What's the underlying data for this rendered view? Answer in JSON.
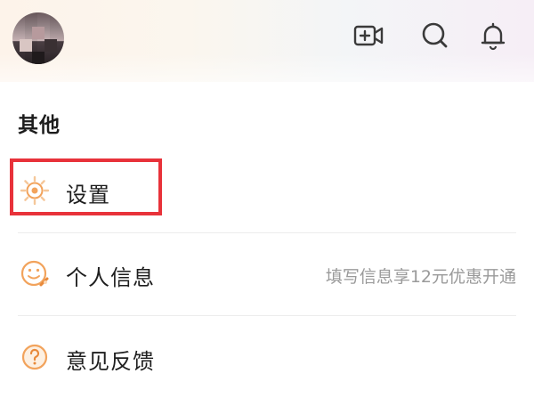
{
  "header": {
    "avatar_desc": "user-avatar",
    "icons": [
      "video-add-icon",
      "search-icon",
      "bell-icon"
    ]
  },
  "section": {
    "title": "其他"
  },
  "menu": {
    "items": [
      {
        "label": "设置",
        "icon": "settings-gear-icon",
        "hint": ""
      },
      {
        "label": "个人信息",
        "icon": "profile-face-icon",
        "hint": "填写信息享12元优惠开通"
      },
      {
        "label": "意见反馈",
        "icon": "feedback-question-icon",
        "hint": ""
      }
    ]
  },
  "colors": {
    "icon_orange": "#f2a35c",
    "highlight_red": "#e8323a",
    "hint_gray": "#9a9a9a"
  }
}
